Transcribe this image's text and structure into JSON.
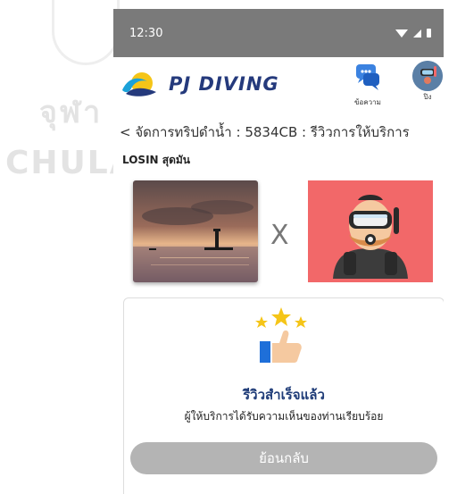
{
  "watermark": {
    "line1": "จุฬา",
    "line2": "CHULA"
  },
  "status_bar": {
    "time": "12:30",
    "icons": [
      "wifi-icon",
      "signal-icon",
      "battery-icon"
    ]
  },
  "app_bar": {
    "brand": "PJ DIVING",
    "messages_label": "ข้อความ",
    "user_label": "ปิง"
  },
  "breadcrumb": "< จัดการทริปดำน้ำ : 5834CB : รีวิวการให้บริการ",
  "user_name": "LOSIN สุดมัน",
  "comparison": {
    "separator": "X",
    "left_image": "sunset-lighthouse-photo",
    "right_image": "scuba-diver-illustration"
  },
  "review_result": {
    "title": "รีวิวสำเร็จแล้ว",
    "description": "ผู้ให้บริการได้รับความเห็นของท่านเรียบร้อย",
    "icon": "thumbs-up-stars-icon",
    "back_label": "ย้อนกลับ"
  },
  "colors": {
    "status_bar": "#7a7a7a",
    "brand": "#253a7c",
    "review_title": "#1f3c78",
    "diver_card": "#f26869",
    "button_disabled": "#b4b4b4"
  }
}
